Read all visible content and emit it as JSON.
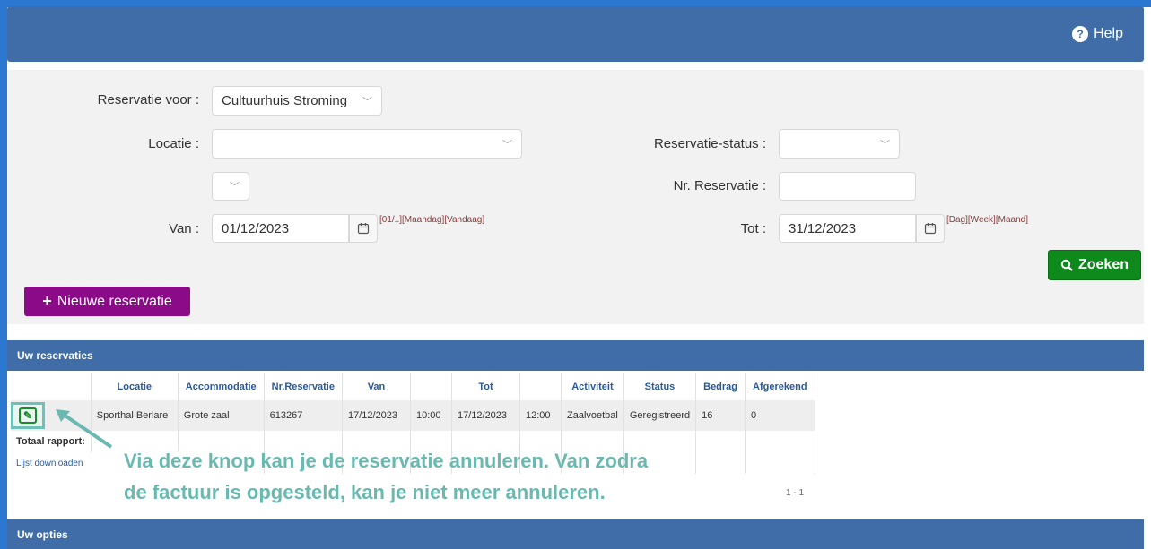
{
  "header": {
    "help_label": "Help",
    "help_icon": "help-circle-icon"
  },
  "form": {
    "reservatie_voor_label": "Reservatie voor :",
    "reservatie_voor_value": "Cultuurhuis Stroming",
    "locatie_label": "Locatie :",
    "locatie_value": "",
    "reservatie_status_label": "Reservatie-status :",
    "reservatie_status_value": "",
    "nr_reservatie_label": "Nr. Reservatie :",
    "nr_reservatie_value": "",
    "van_label": "Van :",
    "van_value": "01/12/2023",
    "van_quick": "[01/..][Maandag][Vandaag]",
    "tot_label": "Tot :",
    "tot_value": "31/12/2023",
    "tot_quick": "[Dag][Week][Maand]",
    "zoeken_label": "Zoeken",
    "nieuwe_reservatie_label": "Nieuwe reservatie"
  },
  "reservaties": {
    "title": "Uw reservaties",
    "columns": [
      "Locatie",
      "Accommodatie",
      "Nr.Reservatie",
      "Van",
      "",
      "Tot",
      "",
      "Activiteit",
      "Status",
      "Bedrag",
      "Afgerekend"
    ],
    "rows": [
      [
        "Sporthal Berlare",
        "Grote zaal",
        "613267",
        "17/12/2023",
        "10:00",
        "17/12/2023",
        "12:00",
        "Zaalvoetbal",
        "Geregistreerd",
        "16",
        "0"
      ]
    ],
    "totaal_label": "Totaal rapport:",
    "download_label": "Lijst downloaden",
    "pager": "1 - 1"
  },
  "annotation": {
    "line1": "Via deze knop kan je de reservatie annuleren. Van zodra",
    "line2": "de factuur is opgesteld, kan je niet meer annuleren."
  },
  "opties": {
    "title": "Uw opties"
  },
  "colors": {
    "accent": "#406da8",
    "success": "#0e8a1c",
    "purple": "#8a0a88",
    "annotation": "#6ab9b1"
  }
}
